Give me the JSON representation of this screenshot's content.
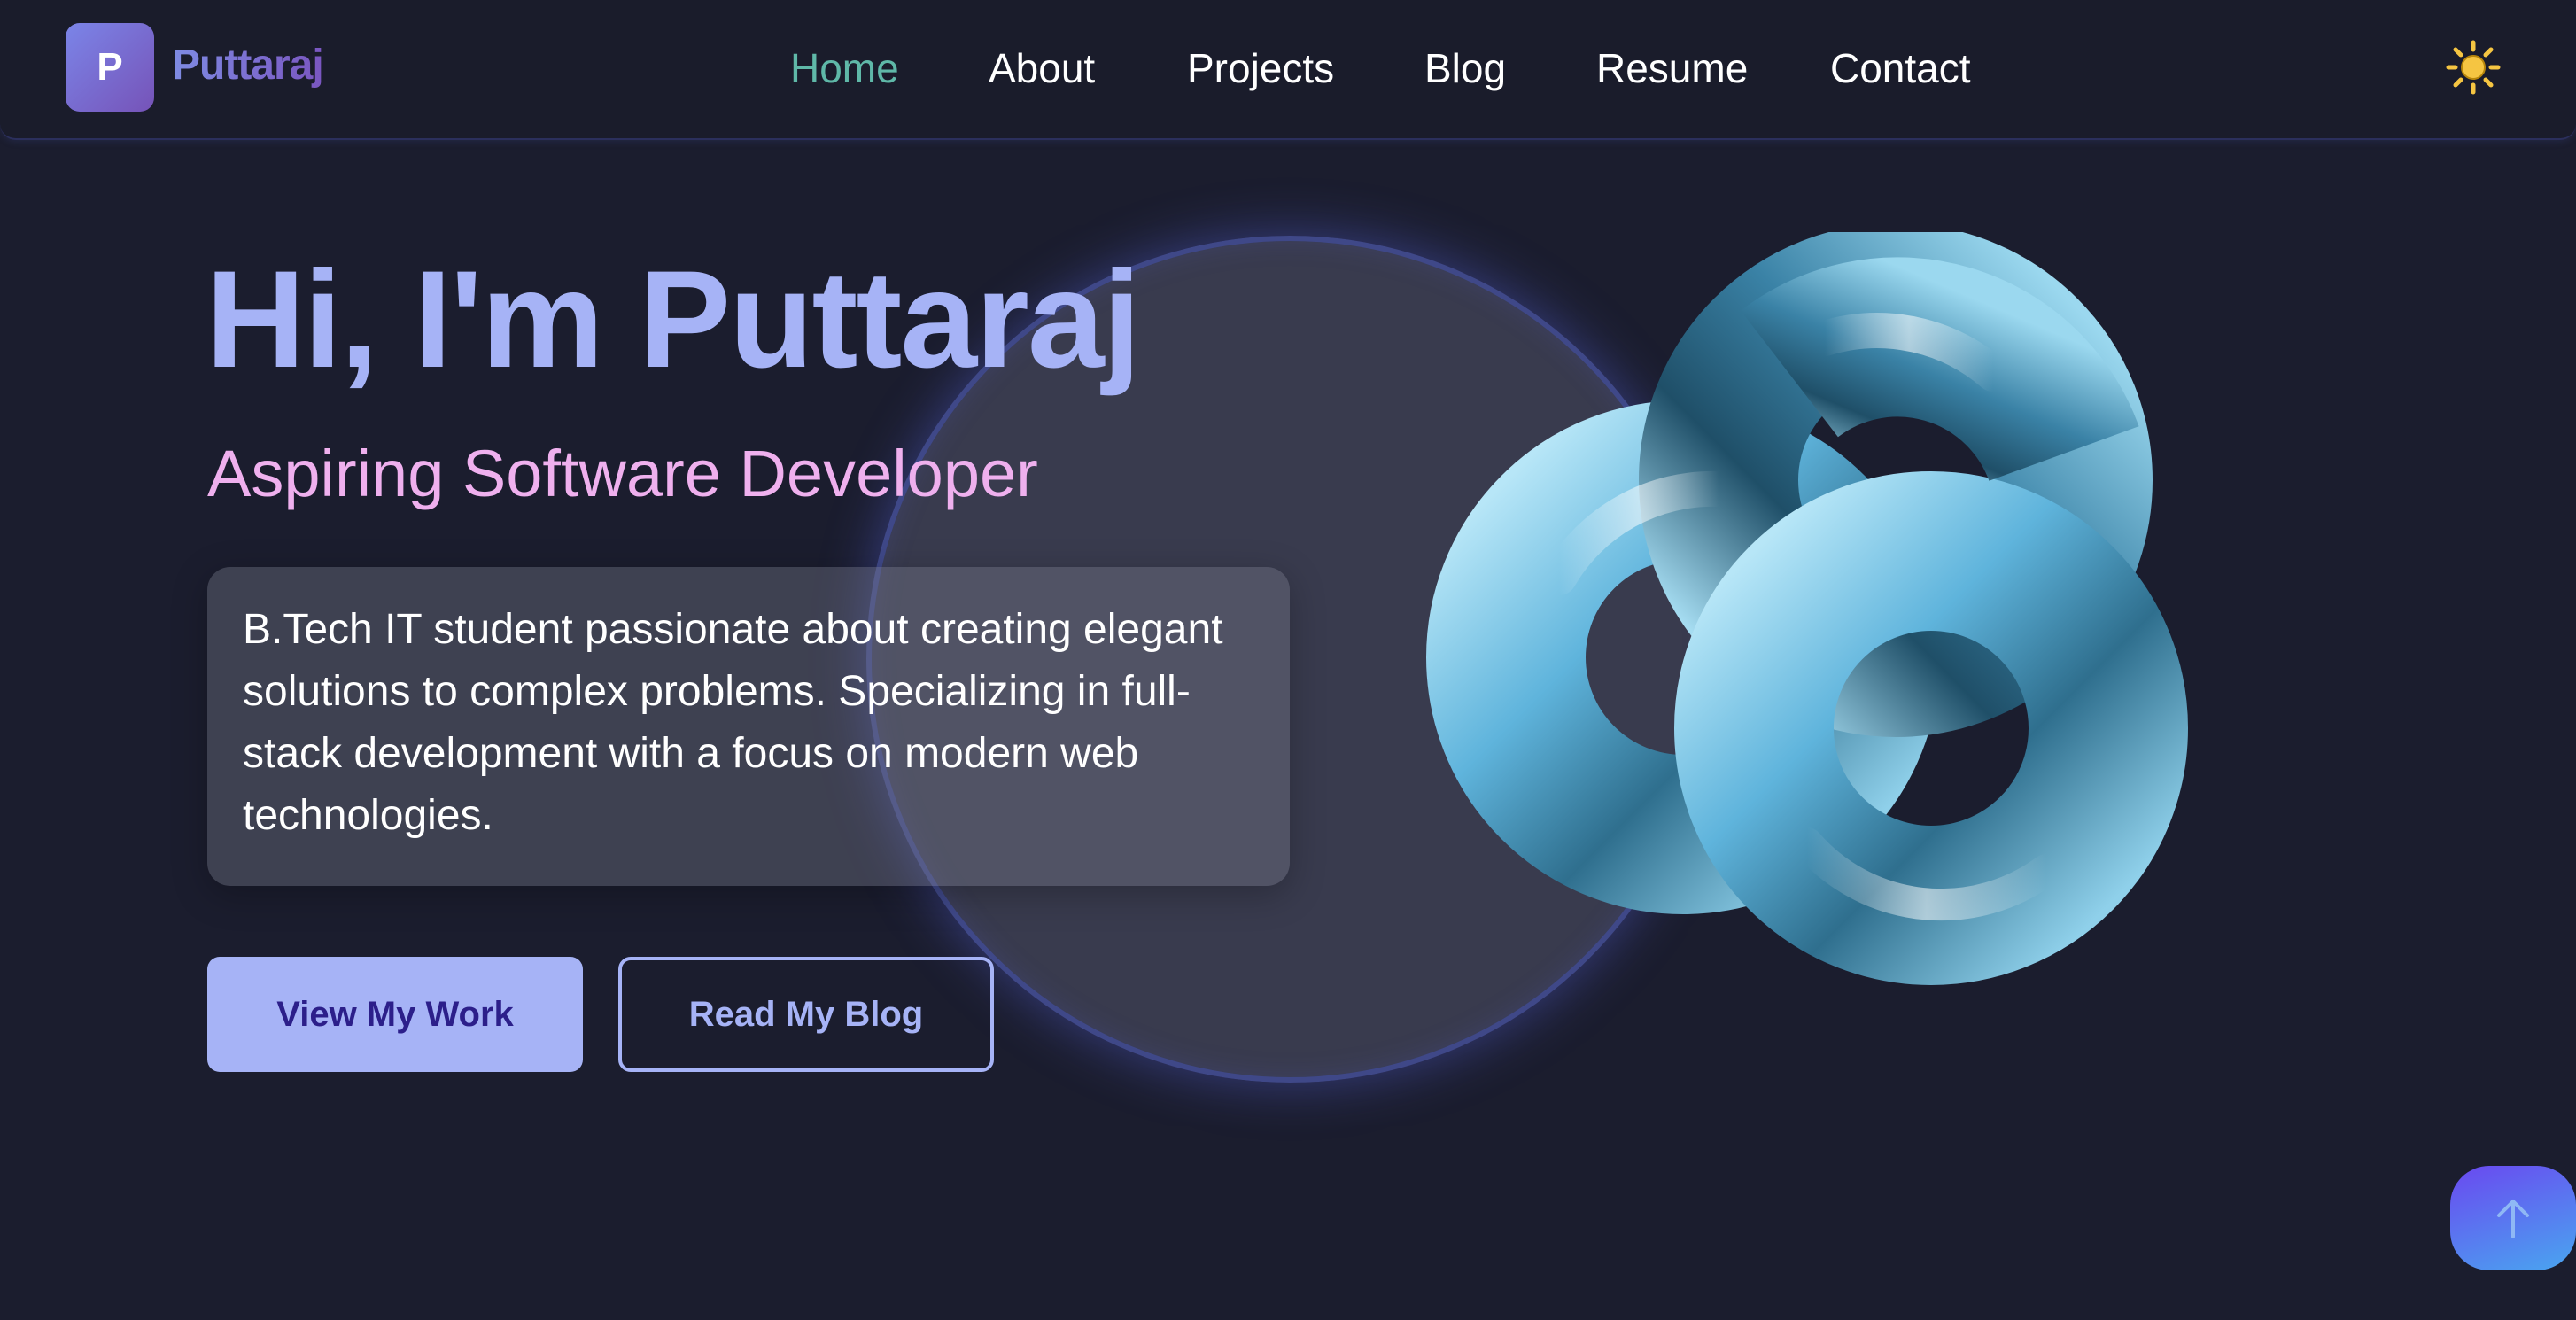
{
  "brand": {
    "logo_letter": "P",
    "name": "Puttaraj"
  },
  "nav": {
    "items": [
      {
        "label": "Home",
        "active": true
      },
      {
        "label": "About",
        "active": false
      },
      {
        "label": "Projects",
        "active": false
      },
      {
        "label": "Blog",
        "active": false
      },
      {
        "label": "Resume",
        "active": false
      },
      {
        "label": "Contact",
        "active": false
      }
    ],
    "theme_toggle_icon": "sun-icon"
  },
  "hero": {
    "title": "Hi, I'm Puttaraj",
    "subtitle": "Aspiring Software Developer",
    "bio": "B.Tech IT student passionate about creating elegant solutions to complex problems. Specializing in full-stack development with a focus on modern web technologies.",
    "primary_button": "View My Work",
    "secondary_button": "Read My Blog"
  },
  "scroll_top_icon": "arrow-up-icon",
  "colors": {
    "background": "#1b1d2e",
    "accent": "#a6b3f6",
    "active_nav": "#5fb8a8",
    "subtitle": "#efb0ee",
    "sun": "#f5c542"
  }
}
